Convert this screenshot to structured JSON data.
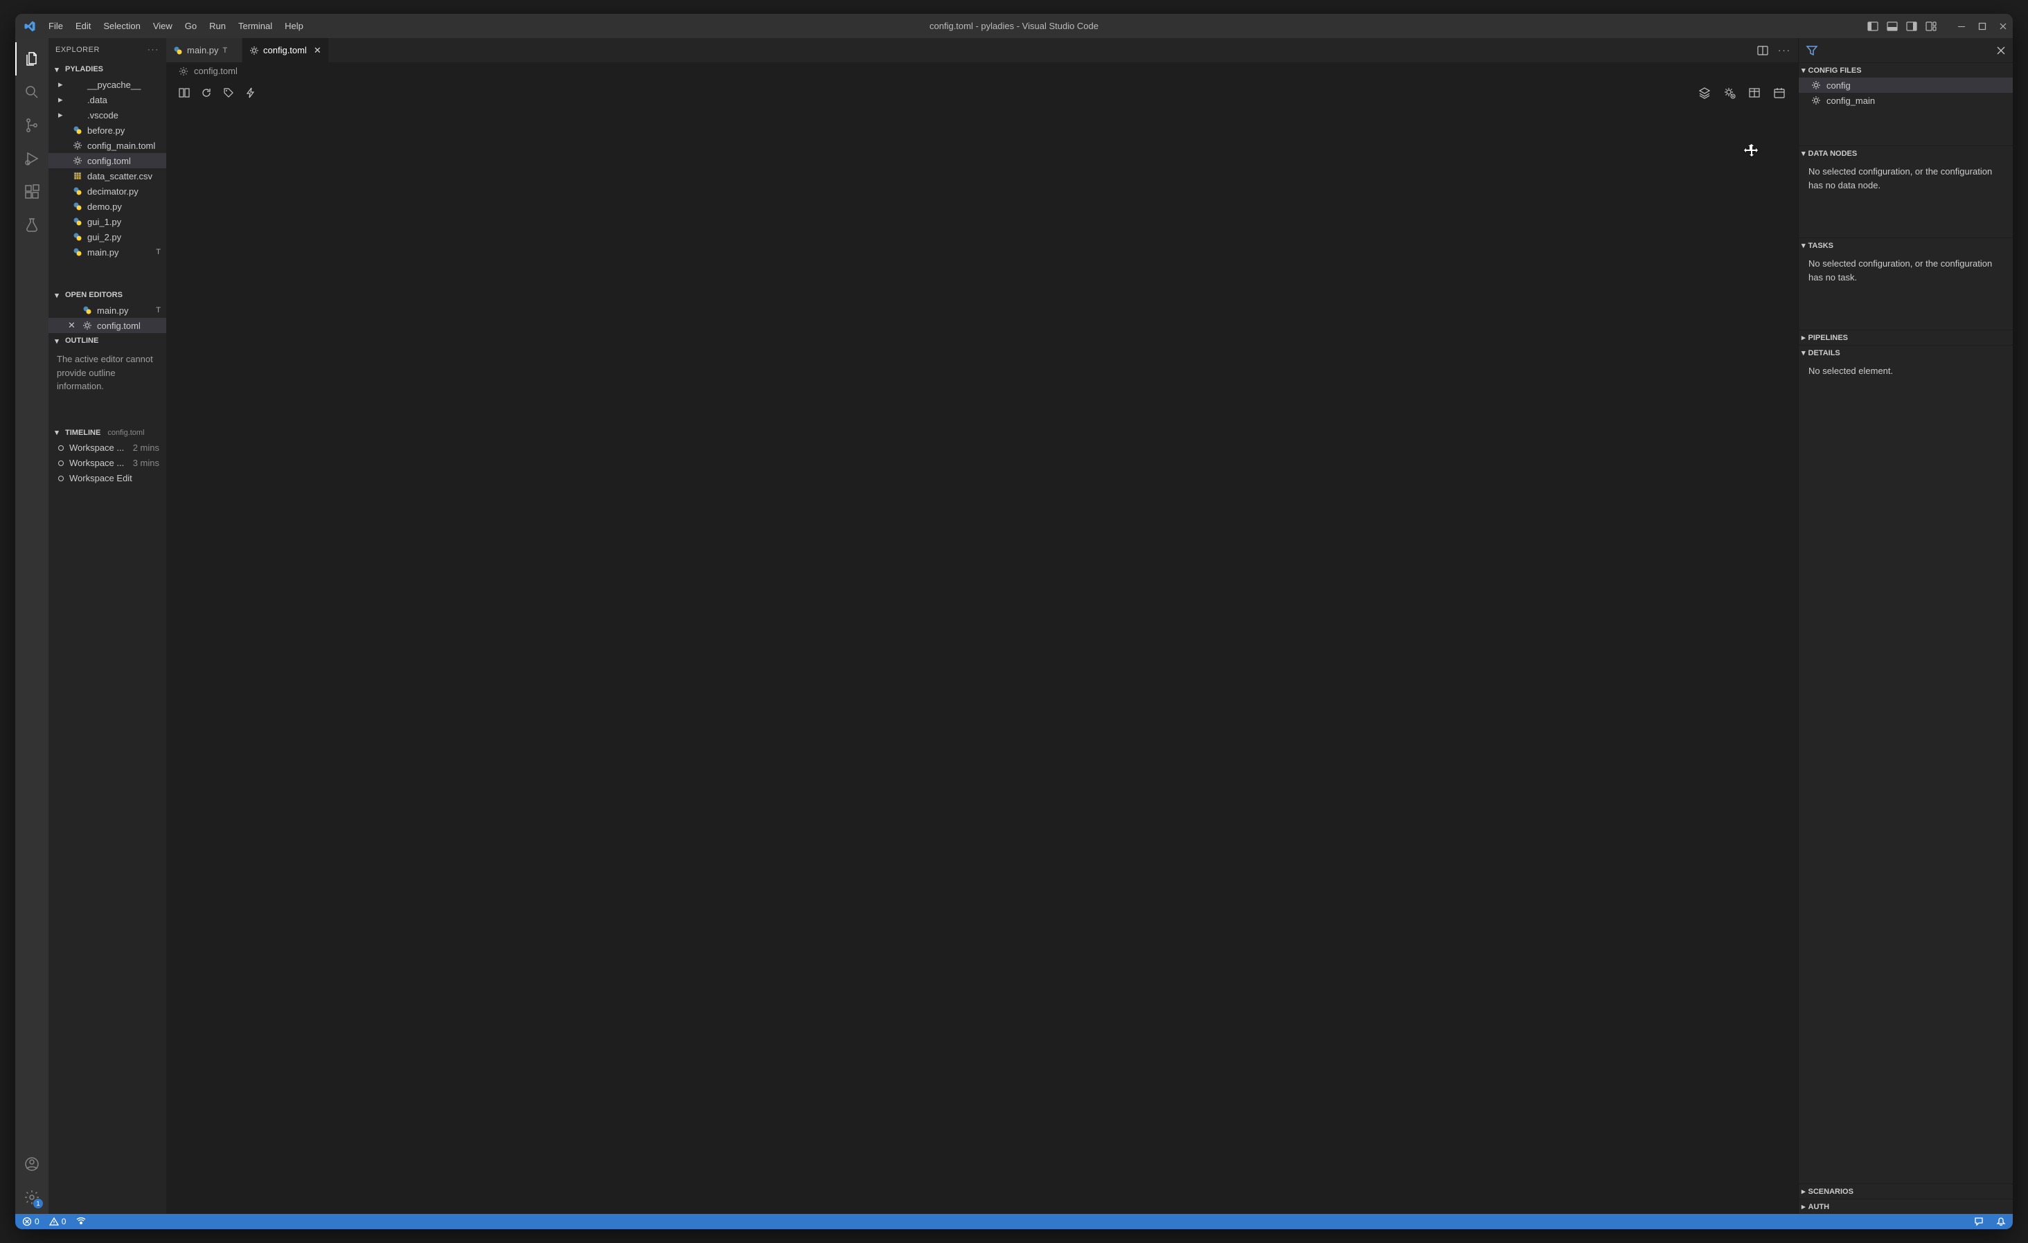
{
  "title": "config.toml - pyladies - Visual Studio Code",
  "menu": [
    "File",
    "Edit",
    "Selection",
    "View",
    "Go",
    "Run",
    "Terminal",
    "Help"
  ],
  "sidebar": {
    "title": "EXPLORER",
    "project": "PYLADIES",
    "files": [
      {
        "name": "__pycache__",
        "type": "folder"
      },
      {
        "name": ".data",
        "type": "folder"
      },
      {
        "name": ".vscode",
        "type": "folder"
      },
      {
        "name": "before.py",
        "type": "py"
      },
      {
        "name": "config_main.toml",
        "type": "toml"
      },
      {
        "name": "config.toml",
        "type": "toml",
        "selected": true
      },
      {
        "name": "data_scatter.csv",
        "type": "csv"
      },
      {
        "name": "decimator.py",
        "type": "py"
      },
      {
        "name": "demo.py",
        "type": "py"
      },
      {
        "name": "gui_1.py",
        "type": "py"
      },
      {
        "name": "gui_2.py",
        "type": "py"
      },
      {
        "name": "main.py",
        "type": "py",
        "tail": "T"
      }
    ],
    "open_editors_title": "OPEN EDITORS",
    "open_editors": [
      {
        "name": "main.py",
        "type": "py",
        "tail": "T"
      },
      {
        "name": "config.toml",
        "type": "toml",
        "selected": true,
        "close": true
      }
    ],
    "outline_title": "OUTLINE",
    "outline_text": "The active editor cannot provide outline information.",
    "timeline_title": "TIMELINE",
    "timeline_sub": "config.toml",
    "timeline": [
      {
        "label": "Workspace ...",
        "time": "2 mins"
      },
      {
        "label": "Workspace ...",
        "time": "3 mins"
      },
      {
        "label": "Workspace Edit",
        "time": ""
      }
    ]
  },
  "tabs": [
    {
      "label": "main.py",
      "type": "py",
      "tail": "T"
    },
    {
      "label": "config.toml",
      "type": "toml",
      "active": true,
      "close": true
    }
  ],
  "breadcrumb": {
    "icon": "toml",
    "label": "config.toml"
  },
  "rightpanel": {
    "sections": {
      "config_files": {
        "title": "CONFIG FILES",
        "items": [
          {
            "name": "config",
            "selected": true
          },
          {
            "name": "config_main"
          }
        ]
      },
      "data_nodes": {
        "title": "DATA NODES",
        "text": "No selected configuration, or the configuration has no data node."
      },
      "tasks": {
        "title": "TASKS",
        "text": "No selected configuration, or the configuration has no task."
      },
      "pipelines": {
        "title": "PIPELINES"
      },
      "details": {
        "title": "DETAILS",
        "text": "No selected element."
      },
      "scenarios": {
        "title": "SCENARIOS"
      },
      "auth": {
        "title": "AUTH"
      }
    }
  },
  "statusbar": {
    "errors": "0",
    "warnings": "0",
    "settings_badge": "1"
  }
}
